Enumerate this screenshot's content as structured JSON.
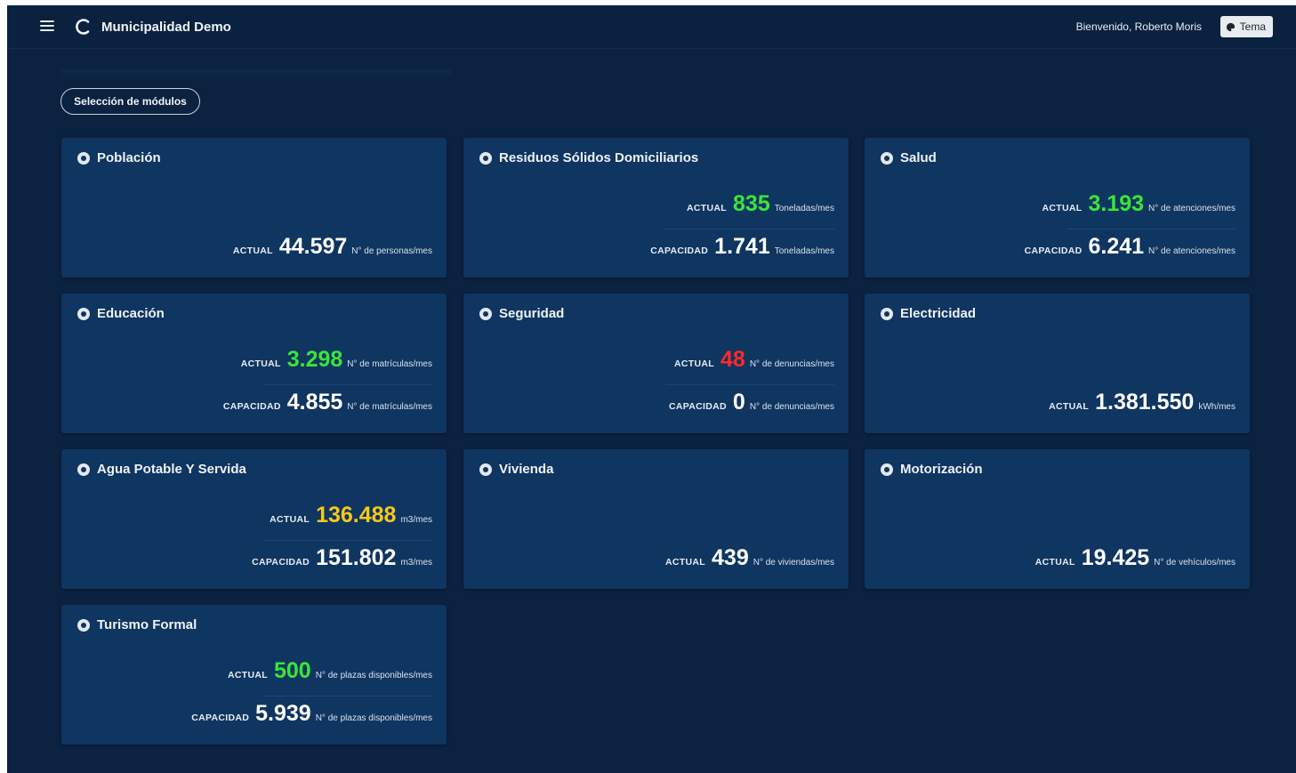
{
  "header": {
    "title": "Municipalidad Demo",
    "welcome": "Bienvenido, Roberto Moris",
    "theme_label": "Tema"
  },
  "modules_button": "Selección de módulos",
  "labels": {
    "actual": "ACTUAL",
    "capacidad": "CAPACIDAD"
  },
  "colors": {
    "green": "#39e639",
    "yellow": "#f6c81c",
    "red": "#ff2a2a",
    "white": "#ffffff",
    "card_bg": "#0f3561",
    "page_bg": "#0b2240"
  },
  "cards": [
    {
      "title": "Población",
      "actual": "44.597",
      "actual_unit": "N° de personas/mes",
      "actual_color": "white"
    },
    {
      "title": "Residuos Sólidos Domiciliarios",
      "actual": "835",
      "actual_unit": "Toneladas/mes",
      "actual_color": "green",
      "capacidad": "1.741",
      "capacidad_unit": "Toneladas/mes"
    },
    {
      "title": "Salud",
      "actual": "3.193",
      "actual_unit": "N° de atenciones/mes",
      "actual_color": "green",
      "capacidad": "6.241",
      "capacidad_unit": "N° de atenciones/mes"
    },
    {
      "title": "Educación",
      "actual": "3.298",
      "actual_unit": "N° de matrículas/mes",
      "actual_color": "green",
      "capacidad": "4.855",
      "capacidad_unit": "N° de matrículas/mes"
    },
    {
      "title": "Seguridad",
      "actual": "48",
      "actual_unit": "N° de denuncias/mes",
      "actual_color": "red",
      "capacidad": "0",
      "capacidad_unit": "N° de denuncias/mes"
    },
    {
      "title": "Electricidad",
      "actual": "1.381.550",
      "actual_unit": "kWh/mes",
      "actual_color": "white"
    },
    {
      "title": "Agua Potable Y Servida",
      "actual": "136.488",
      "actual_unit": "m3/mes",
      "actual_color": "yellow",
      "capacidad": "151.802",
      "capacidad_unit": "m3/mes"
    },
    {
      "title": "Vivienda",
      "actual": "439",
      "actual_unit": "N° de viviendas/mes",
      "actual_color": "white"
    },
    {
      "title": "Motorización",
      "actual": "19.425",
      "actual_unit": "N° de vehículos/mes",
      "actual_color": "white"
    },
    {
      "title": "Turismo Formal",
      "actual": "500",
      "actual_unit": "N° de plazas disponibles/mes",
      "actual_color": "green",
      "capacidad": "5.939",
      "capacidad_unit": "N° de plazas disponibles/mes"
    }
  ]
}
